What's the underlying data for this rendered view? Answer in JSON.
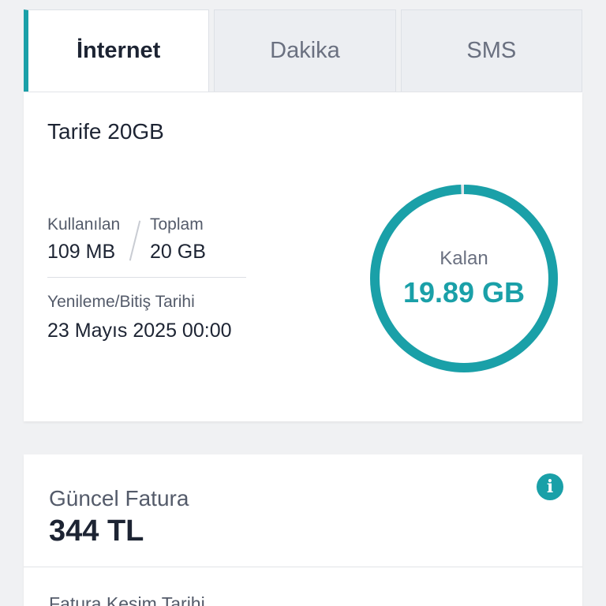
{
  "tabs": [
    {
      "label": "İnternet",
      "active": true
    },
    {
      "label": "Dakika",
      "active": false
    },
    {
      "label": "SMS",
      "active": false
    }
  ],
  "usage": {
    "plan_name": "Tarife 20GB",
    "used_label": "Kullanılan",
    "used_value": "109 MB",
    "total_label": "Toplam",
    "total_value": "20 GB",
    "renew_label": "Yenileme/Bitiş Tarihi",
    "renew_value": "23 Mayıs 2025 00:00",
    "remaining_label": "Kalan",
    "remaining_value": "19.89 GB",
    "remaining_fraction": 0.9945
  },
  "bill": {
    "title": "Güncel Fatura",
    "amount": "344 TL",
    "cut_date_label": "Fatura Kesim Tarihi"
  },
  "colors": {
    "accent": "#1aa0a8",
    "text_dark": "#1d2433",
    "text_muted": "#545b6a",
    "background": "#f0f1f3"
  },
  "icons": {
    "info": "info-icon"
  }
}
